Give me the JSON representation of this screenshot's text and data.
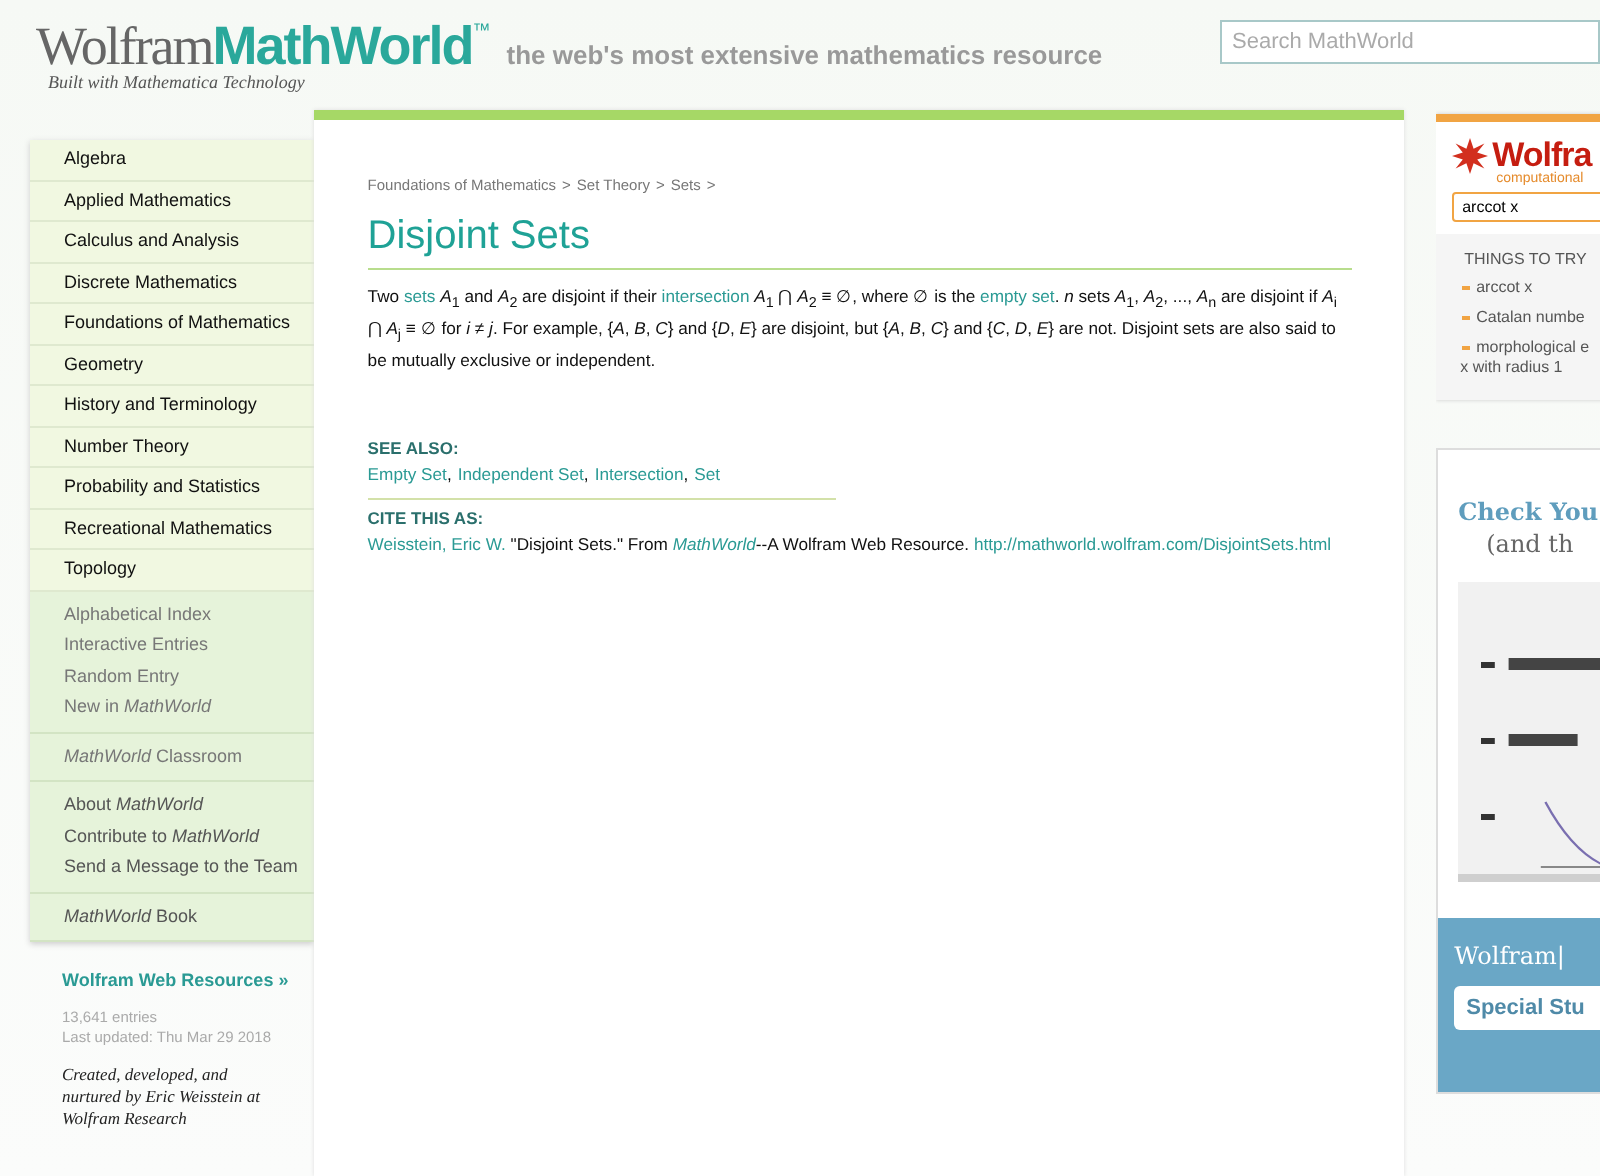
{
  "header": {
    "logo_word": "Wolfram",
    "logo_product": "MathWorld",
    "logo_mark": "™",
    "logo_subtitle": "Built with Mathematica Technology",
    "tagline": "the web's most extensive mathematics resource",
    "search": {
      "placeholder": "Search MathWorld"
    }
  },
  "nav": {
    "topics": [
      "Algebra",
      "Applied Mathematics",
      "Calculus and Analysis",
      "Discrete Mathematics",
      "Foundations of Mathematics",
      "Geometry",
      "History and Terminology",
      "Number Theory",
      "Probability and Statistics",
      "Recreational Mathematics",
      "Topology"
    ],
    "groups": [
      [
        "Alphabetical Index",
        "Interactive Entries",
        "Random Entry",
        "New in *MathWorld*"
      ],
      [
        "*MathWorld* Classroom"
      ],
      [
        "About *MathWorld*",
        "Contribute to *MathWorld*",
        "Send a Message to the Team"
      ],
      [
        "*MathWorld* Book"
      ]
    ]
  },
  "sidebar_footer": {
    "resources_link": "Wolfram Web Resources »",
    "entries": "13,641 entries",
    "updated": "Last updated: Thu Mar 29 2018",
    "credit": "Created, developed, and nurtured by Eric Weisstein at Wolfram Research"
  },
  "breadcrumb": [
    "Foundations of Mathematics",
    "Set Theory",
    "Sets"
  ],
  "breadcrumb_separator": ">",
  "title": "Disjoint Sets",
  "paragraph": [
    {
      "kind": "text",
      "text": "Two "
    },
    {
      "kind": "link",
      "text": "sets"
    },
    {
      "kind": "text",
      "text": " *A*$_{1}$ and *A*$_{2}$ are disjoint if their "
    },
    {
      "kind": "link",
      "text": "intersection"
    },
    {
      "kind": "text",
      "text": " *A*$_{1}$ ⋂ *A*$_{2}$ ≡ ∅, where ∅ is the "
    },
    {
      "kind": "link",
      "text": "empty set"
    },
    {
      "kind": "text",
      "text": ". *n* sets *A*$_{1}$, *A*$_{2}$, ..., *A*$_{n}$ are disjoint if *A*$_{i}$ ⋂ *A*$_{j}$ ≡ ∅ for *i* ≠ *j*. For example, {*A*, *B*, *C*} and {*D*, *E*} are disjoint, but {*A*, *B*, *C*} and {*C*, *D*, *E*} are not. Disjoint sets are also said to be mutually exclusive or independent."
    }
  ],
  "see_also": {
    "heading": "SEE ALSO:",
    "links": [
      "Empty Set",
      "Independent Set",
      "Intersection",
      "Set"
    ],
    "separator": ","
  },
  "cite": {
    "heading": "CITE THIS AS:",
    "parts": [
      {
        "kind": "link",
        "text": "Weisstein, Eric W."
      },
      {
        "kind": "text",
        "text": " \"Disjoint Sets.\" From "
      },
      {
        "kind": "italic-link",
        "text": "MathWorld"
      },
      {
        "kind": "text",
        "text": "--A Wolfram Web Resource. "
      },
      {
        "kind": "link",
        "text": "http://mathworld.wolfram.com/DisjointSets.html"
      }
    ]
  },
  "alpha_widget": {
    "logo": "Wolfra",
    "subtitle": "computational",
    "input": "arccot x",
    "heading": "THINGS TO TRY",
    "items": [
      "arccot x",
      "Catalan numbe",
      "morphological e\nx with radius 1"
    ]
  },
  "ad": {
    "headline": "Check You",
    "subline": "(and th",
    "brand": "Wolfram|",
    "button": "Special Stu"
  }
}
